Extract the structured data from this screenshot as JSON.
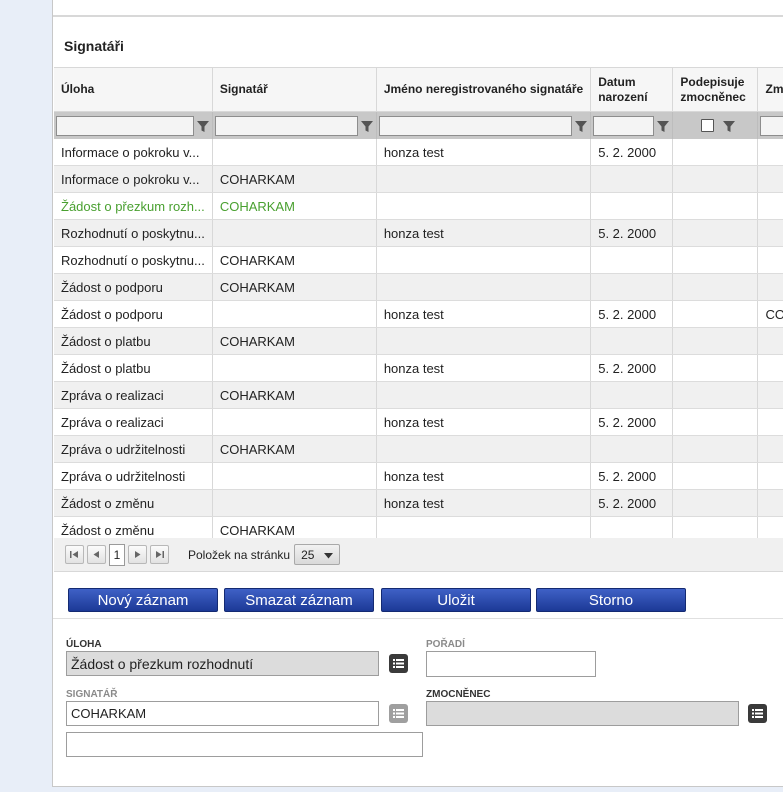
{
  "section": {
    "title": "Signatáři"
  },
  "table": {
    "headers": {
      "uloha": "Úloha",
      "signatar": "Signatář",
      "jmeno": "Jméno neregistrovaného signatáře",
      "datum_1": "Datum",
      "datum_2": "narození",
      "podepisuje_1": "Podepisuje",
      "podepisuje_2": "zmocněnec",
      "extra": "Zm"
    },
    "rows": [
      {
        "uloha": "Informace o pokroku v...",
        "signatar": "",
        "jmeno": "honza test",
        "datum": "5. 2. 2000",
        "extra": ""
      },
      {
        "uloha": "Informace o pokroku v...",
        "signatar": "COHARKAM",
        "jmeno": "",
        "datum": "",
        "extra": ""
      },
      {
        "uloha": "Žádost o přezkum rozh...",
        "signatar": "COHARKAM",
        "jmeno": "",
        "datum": "",
        "extra": ""
      },
      {
        "uloha": "Rozhodnutí o poskytnu...",
        "signatar": "",
        "jmeno": "honza test",
        "datum": "5. 2. 2000",
        "extra": ""
      },
      {
        "uloha": "Rozhodnutí o poskytnu...",
        "signatar": "COHARKAM",
        "jmeno": "",
        "datum": "",
        "extra": ""
      },
      {
        "uloha": "Žádost o podporu",
        "signatar": "COHARKAM",
        "jmeno": "",
        "datum": "",
        "extra": ""
      },
      {
        "uloha": "Žádost o podporu",
        "signatar": "",
        "jmeno": "honza test",
        "datum": "5. 2. 2000",
        "extra": "CO"
      },
      {
        "uloha": "Žádost o platbu",
        "signatar": "COHARKAM",
        "jmeno": "",
        "datum": "",
        "extra": ""
      },
      {
        "uloha": "Žádost o platbu",
        "signatar": "",
        "jmeno": "honza test",
        "datum": "5. 2. 2000",
        "extra": ""
      },
      {
        "uloha": "Zpráva o realizaci",
        "signatar": "COHARKAM",
        "jmeno": "",
        "datum": "",
        "extra": ""
      },
      {
        "uloha": "Zpráva o realizaci",
        "signatar": "",
        "jmeno": "honza test",
        "datum": "5. 2. 2000",
        "extra": ""
      },
      {
        "uloha": "Zpráva o udržitelnosti",
        "signatar": "COHARKAM",
        "jmeno": "",
        "datum": "",
        "extra": ""
      },
      {
        "uloha": "Zpráva o udržitelnosti",
        "signatar": "",
        "jmeno": "honza test",
        "datum": "5. 2. 2000",
        "extra": ""
      },
      {
        "uloha": "Žádost o změnu",
        "signatar": "",
        "jmeno": "honza test",
        "datum": "5. 2. 2000",
        "extra": ""
      },
      {
        "uloha": "Žádost o změnu",
        "signatar": "COHARKAM",
        "jmeno": "",
        "datum": "",
        "extra": ""
      }
    ]
  },
  "pager": {
    "page": "1",
    "per_page_label": "Položek na stránku",
    "per_page": "25"
  },
  "buttons": {
    "new": "Nový záznam",
    "delete": "Smazat záznam",
    "save": "Uložit",
    "cancel": "Storno"
  },
  "form": {
    "uloha_label": "Úloha",
    "uloha_value": "Žádost o přezkum rozhodnutí",
    "poradi_label": "Pořadí",
    "poradi_value": "",
    "signatar_label": "Signatář",
    "signatar_value": "COHARKAM",
    "zmocnenec_label": "Zmocněnec",
    "zmocnenec_value": "",
    "extra_value": ""
  },
  "colors": {
    "button": "#2745a8",
    "selected_row_text": "#49a030",
    "filter_bar": "#c8c8c8"
  }
}
